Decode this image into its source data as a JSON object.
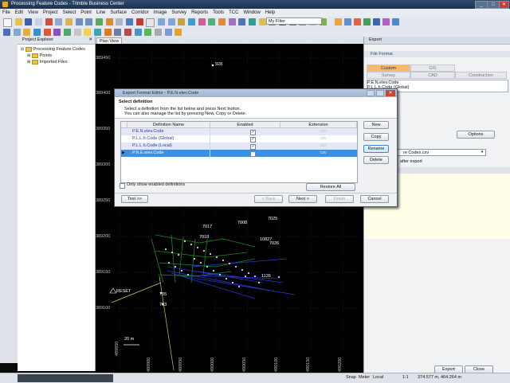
{
  "window": {
    "title": "Processing Feature Codes - Trimble Business Center",
    "controls": [
      "_",
      "□",
      "✕"
    ]
  },
  "menu": [
    "File",
    "Edit",
    "View",
    "Project",
    "Select",
    "Point",
    "Line",
    "Surface",
    "Corridor",
    "Image",
    "Survey",
    "Reports",
    "Tools",
    "TCC",
    "Window",
    "Help"
  ],
  "toolbar": {
    "filter_value": "My Filter"
  },
  "explorer": {
    "title": "Project Explorer",
    "tree": [
      {
        "label": "Processing Feature Codes",
        "level": 0
      },
      {
        "label": "Points",
        "level": 1
      },
      {
        "label": "Imported Files",
        "level": 1
      }
    ]
  },
  "plan_view": {
    "tab": "Plan View",
    "northings": [
      "389450",
      "389400",
      "389350",
      "389300",
      "389250",
      "389200",
      "389150",
      "389100"
    ],
    "eastings": [
      "489850",
      "489900",
      "489950",
      "490000",
      "490050",
      "490100",
      "490150",
      "490200"
    ],
    "points": [
      "928",
      "7025",
      "7017",
      "7018",
      "7026",
      "1126",
      "705",
      "703",
      "7008",
      "10827"
    ],
    "control_label": "RESET",
    "scale_label": "20 m"
  },
  "export_panel": {
    "title": "Export",
    "section": "File Format",
    "tabs": [
      "Custom",
      "GIS",
      "Survey",
      "CAD",
      "Construction"
    ],
    "list": [
      "P.E.N.elev.Code",
      "P.L.L.h.Code (Global)"
    ],
    "options_button": "Options",
    "filename": "re Codes.csv",
    "after_export": "after export",
    "export_button": "Export",
    "close_button": "Close"
  },
  "dialog": {
    "title": "Export Format Editor - P.E.N.elev.Code",
    "heading": "Select definition",
    "instructions": [
      "Select a definition from the list below and press Next button.",
      "You can also manage the list by pressing New, Copy or Delete."
    ],
    "columns": [
      "Definition Name",
      "Enabled",
      "Extension"
    ],
    "rows": [
      {
        "name": "P.E.N.elev.Code",
        "enabled": true,
        "ext": "csv"
      },
      {
        "name": "P.L.L.h.Code (Global)",
        "enabled": true,
        "ext": "csv"
      },
      {
        "name": "P.L.L.h.Code (Local)",
        "enabled": true,
        "ext": "csv"
      },
      {
        "name": "P.N.E.elev.Code",
        "enabled": true,
        "ext": "csv"
      }
    ],
    "side_buttons": [
      "New",
      "Copy",
      "Rename",
      "Delete"
    ],
    "only_enabled": "Only show enabled definitions",
    "restore_all": "Restore All",
    "test": "Test >>",
    "back": "< Back",
    "next": "Next >",
    "finish": "Finish",
    "cancel": "Cancel"
  },
  "status": {
    "snap": "Snap",
    "units": "Meter",
    "coord_mode": "Local",
    "scale": "1:1",
    "coords": "374.577 m, 464.264 m"
  }
}
